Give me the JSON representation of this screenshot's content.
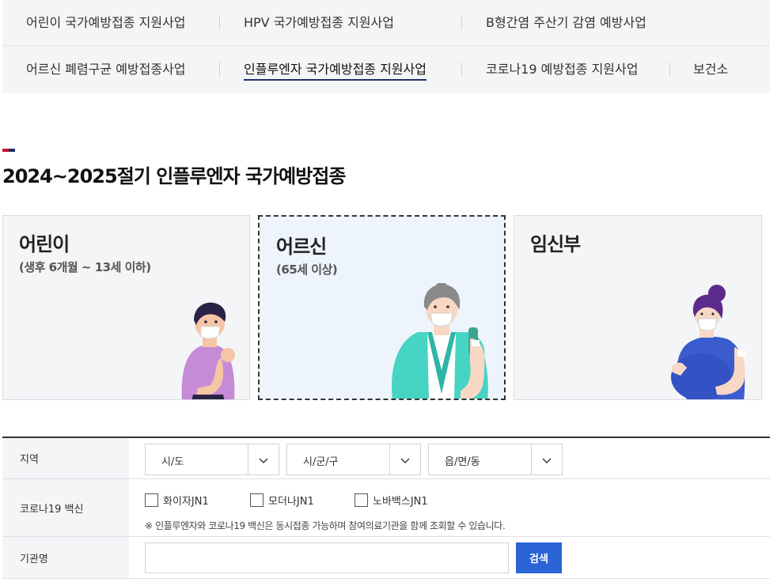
{
  "nav": {
    "row1": [
      {
        "label": "어린이 국가예방접종 지원사업"
      },
      {
        "label": "HPV 국가예방접종 지원사업"
      },
      {
        "label": "B형간염 주산기 감염 예방사업"
      }
    ],
    "row2": [
      {
        "label": "어르신 폐렴구균 예방접종사업"
      },
      {
        "label": "인플루엔자 국가예방접종 지원사업",
        "active": true
      },
      {
        "label": "코로나19 예방접종 지원사업"
      },
      {
        "label": "보건소"
      }
    ]
  },
  "page": {
    "title": "2024~2025절기 인플루엔자 국가예방접종"
  },
  "cards": [
    {
      "title": "어린이",
      "subtitle": "(생후 6개월 ~ 13세 이하)",
      "selected": false
    },
    {
      "title": "어르신",
      "subtitle": "(65세 이상)",
      "selected": true
    },
    {
      "title": "임신부",
      "subtitle": "",
      "selected": false
    }
  ],
  "form": {
    "region_label": "지역",
    "selects": [
      {
        "value": "시/도"
      },
      {
        "value": "시/군/구"
      },
      {
        "value": "읍/면/동"
      }
    ],
    "vaccine_label": "코로나19 백신",
    "vaccines": [
      {
        "label": "화이자JN1",
        "checked": false
      },
      {
        "label": "모더나JN1",
        "checked": false
      },
      {
        "label": "노바백스JN1",
        "checked": false
      }
    ],
    "vaccine_note": "※ 인플루엔자와 코로나19 백신은 동시접종 가능하며 참여의료기관을 함께 조회할 수 있습니다.",
    "institution_label": "기관명",
    "institution_value": "",
    "search_label": "검색"
  },
  "colors": {
    "accent_blue": "#2a64d6",
    "nav_underline": "#1f2f6e",
    "title_mark_red": "#d0112b",
    "title_mark_navy": "#1f2f6e",
    "card_selected_bg": "#eef4fc"
  },
  "icons": [
    "chevron-down-icon",
    "title-flag-mark"
  ]
}
